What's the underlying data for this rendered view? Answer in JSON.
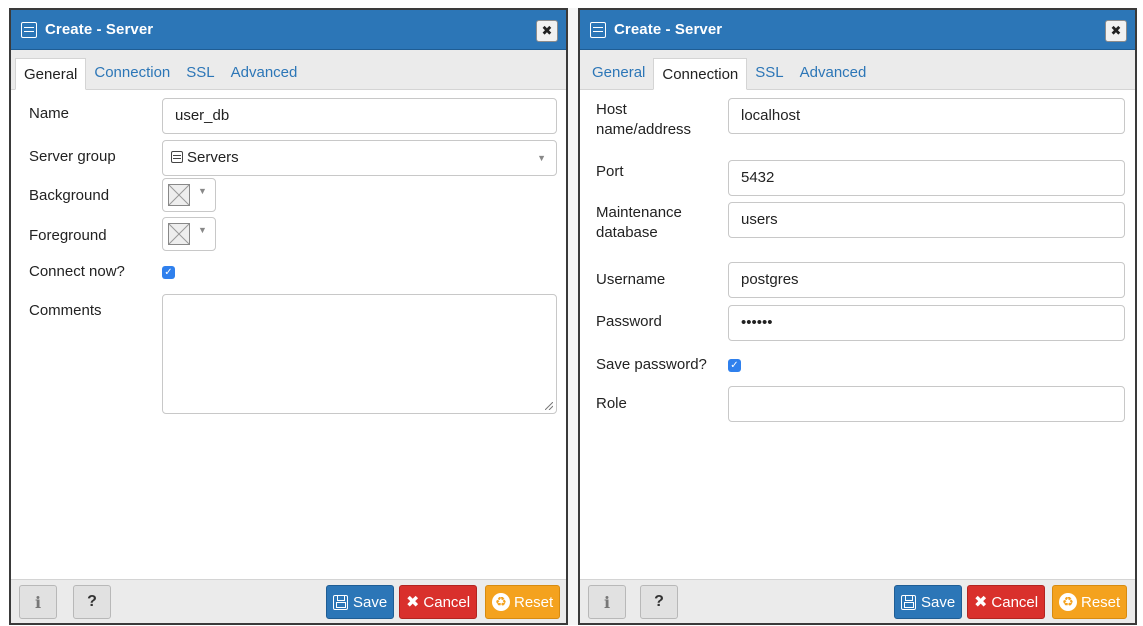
{
  "left_dialog": {
    "title": "Create - Server",
    "tabs": [
      "General",
      "Connection",
      "SSL",
      "Advanced"
    ],
    "active_tab": "General",
    "fields": {
      "name_label": "Name",
      "name_value": "user_db",
      "server_group_label": "Server group",
      "server_group_value": "Servers",
      "background_label": "Background",
      "foreground_label": "Foreground",
      "connect_now_label": "Connect now?",
      "connect_now_checked": true,
      "comments_label": "Comments",
      "comments_value": ""
    }
  },
  "right_dialog": {
    "title": "Create - Server",
    "tabs": [
      "General",
      "Connection",
      "SSL",
      "Advanced"
    ],
    "active_tab": "Connection",
    "fields": {
      "host_label_1": "Host",
      "host_label_2": "name/address",
      "host_value": "localhost",
      "port_label": "Port",
      "port_value": "5432",
      "maint_label_1": "Maintenance",
      "maint_label_2": "database",
      "maint_value": "users",
      "username_label": "Username",
      "username_value": "postgres",
      "password_label": "Password",
      "password_value": "••••••",
      "save_password_label": "Save password?",
      "save_password_checked": true,
      "role_label": "Role",
      "role_value": ""
    }
  },
  "footer": {
    "info_glyph": "i",
    "help_glyph": "?",
    "save_label": "Save",
    "cancel_label": "Cancel",
    "reset_label": "Reset"
  },
  "colors": {
    "titlebar": "#2c76b7",
    "save": "#2c76b7",
    "cancel": "#d9302c",
    "reset": "#f4a21e",
    "checkbox": "#2f80ed",
    "tab_link": "#2c76b7"
  }
}
